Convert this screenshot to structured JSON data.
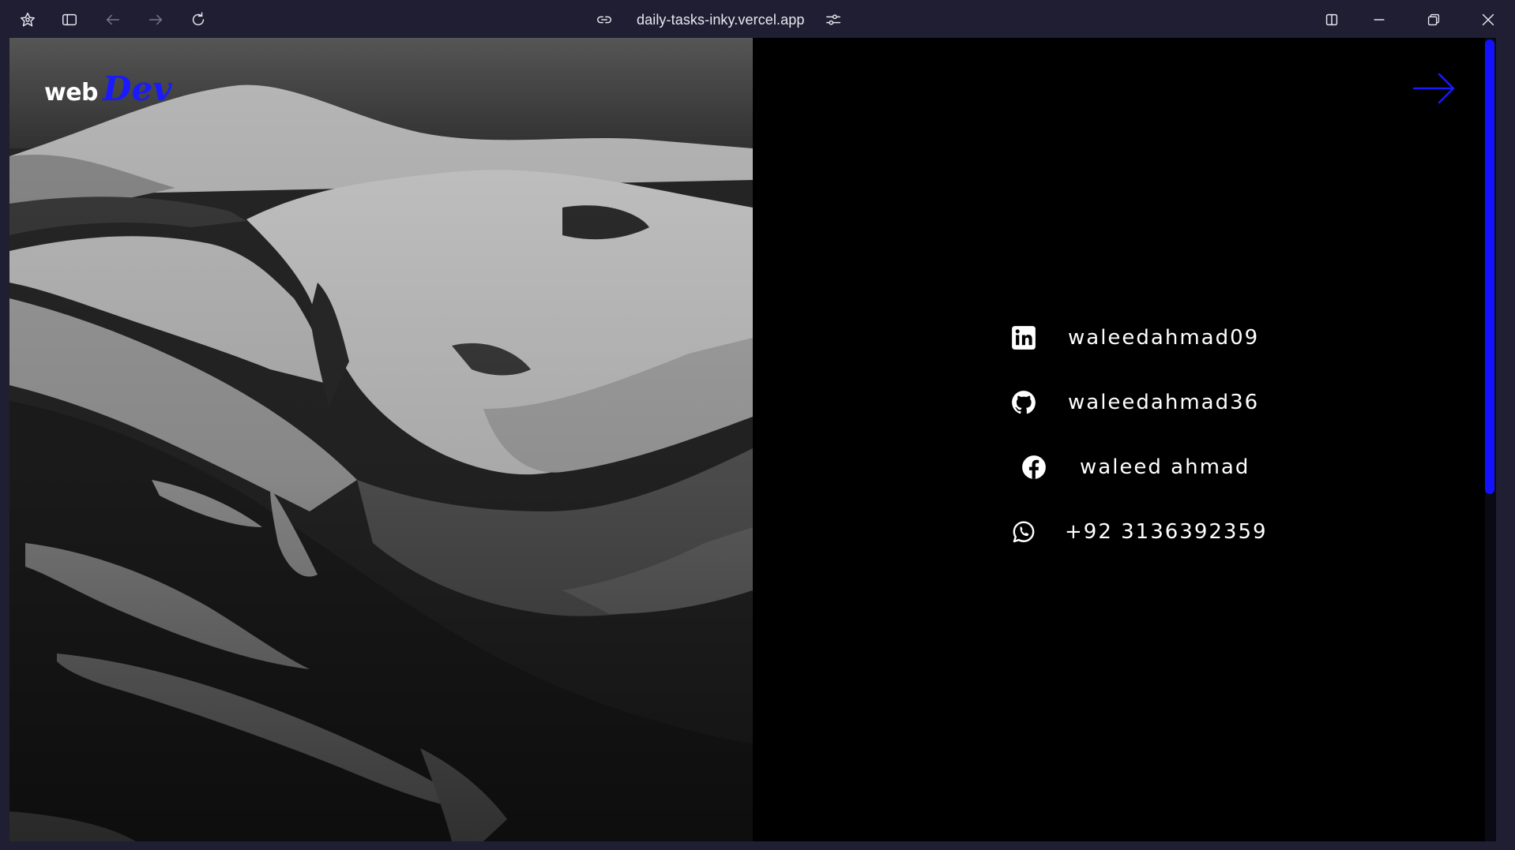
{
  "browser": {
    "url": "daily-tasks-inky.vercel.app",
    "icons": {
      "app": "app-logo-icon",
      "sidebar": "sidebar-toggle-icon",
      "back": "back-arrow-icon",
      "forward": "forward-arrow-icon",
      "reload": "reload-icon",
      "link": "link-icon",
      "site_settings": "site-settings-icon",
      "split": "split-view-icon",
      "minimize": "minimize-icon",
      "restore": "restore-icon",
      "close": "close-icon"
    }
  },
  "page": {
    "logo": {
      "part1": "web",
      "part2": "Dev"
    },
    "accent_color": "#1a1aff",
    "next_icon": "arrow-right-icon",
    "contacts": [
      {
        "icon": "linkedin-icon",
        "label": "waleedahmad09"
      },
      {
        "icon": "github-icon",
        "label": "waleedahmad36"
      },
      {
        "icon": "facebook-icon",
        "label": "waleed ahmad"
      },
      {
        "icon": "whatsapp-icon",
        "label": "+92 3136392359"
      }
    ]
  }
}
